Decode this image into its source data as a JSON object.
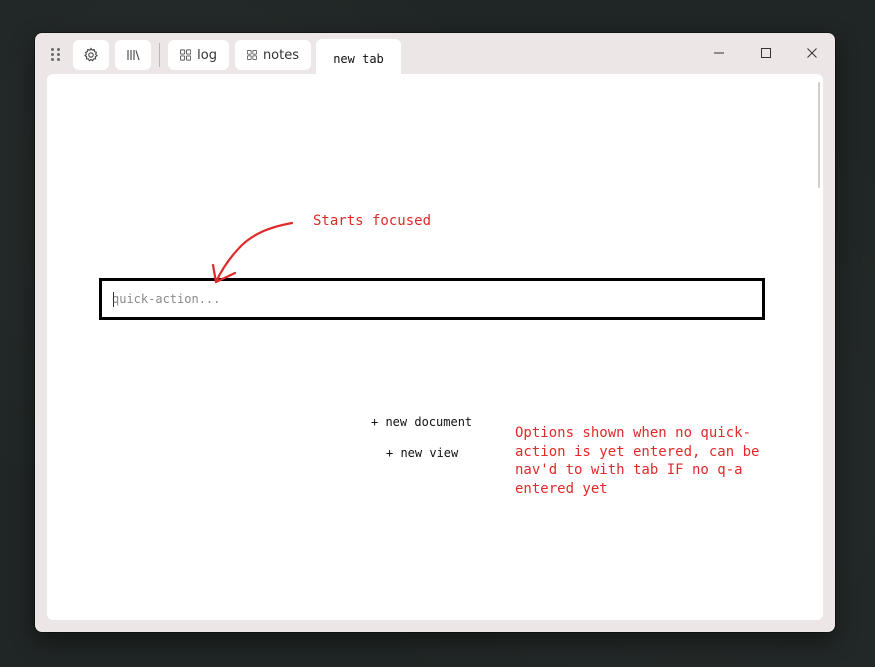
{
  "titlebar": {
    "settings_icon": "gear-icon",
    "library_icon": "library-icon",
    "tabs": [
      {
        "label": "log",
        "icon": "grid-icon"
      },
      {
        "label": "notes",
        "icon": "grid-icon"
      }
    ],
    "active_tab": {
      "label": "new tab"
    },
    "window_controls": [
      "minimize-icon",
      "maximize-icon",
      "close-icon"
    ]
  },
  "quick_action": {
    "placeholder": "quick-action...",
    "value": ""
  },
  "options": [
    {
      "label": "+ new document"
    },
    {
      "label": "+ new view"
    }
  ],
  "annotations": {
    "focus_note": "Starts focused",
    "options_note": "Options shown when no quick-\naction is yet entered, can be\nnav'd to with tab IF no q-a\nentered yet",
    "color": "#e02a2a"
  }
}
